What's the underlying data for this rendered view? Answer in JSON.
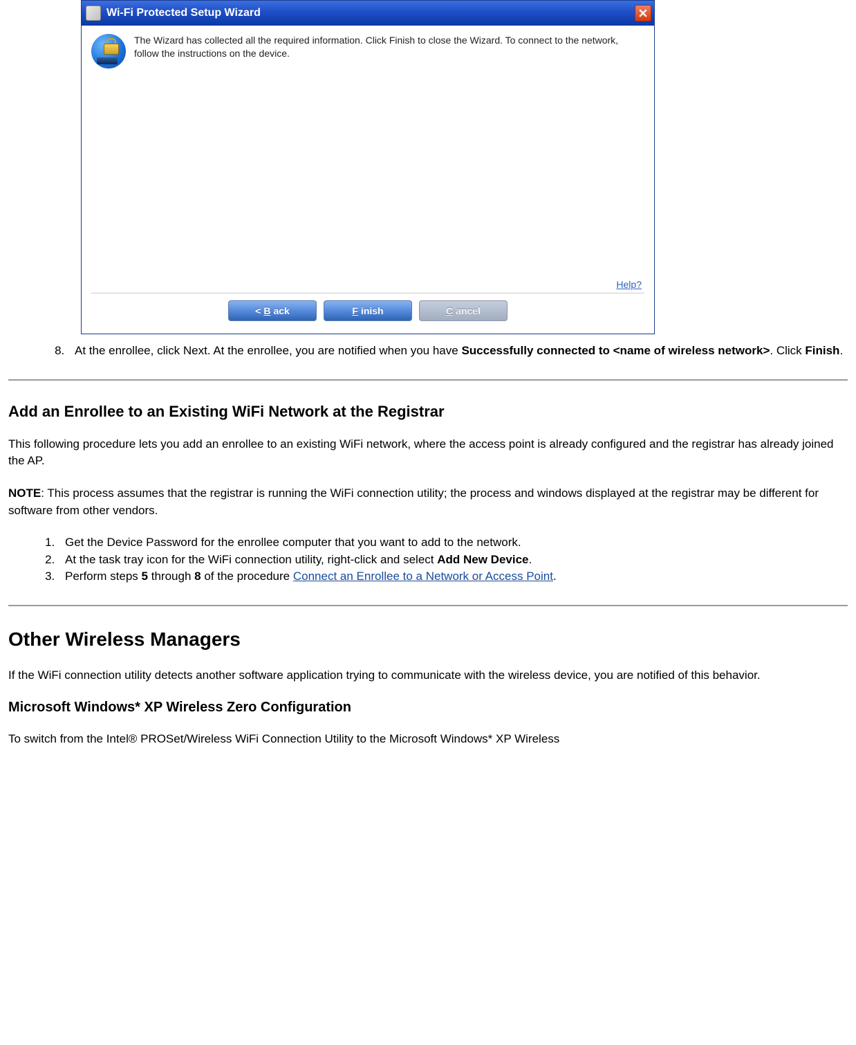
{
  "wizard": {
    "title": "Wi-Fi Protected Setup Wizard",
    "message": "The Wizard has collected all the required information. Click Finish to close the Wizard. To connect to the network, follow the instructions on the device.",
    "help_label": "Help?",
    "buttons": {
      "back_prefix": "<  ",
      "back_letter": "B",
      "back_rest": "ack",
      "finish_letter": "F",
      "finish_rest": "inish",
      "cancel_letter": "C",
      "cancel_rest": "ancel"
    }
  },
  "step8": {
    "number": "8.",
    "prefix": "At the enrollee, click Next. At the enrollee, you are notified when you have ",
    "bold1": "Successfully connected to <name of wireless network>",
    "mid": ". Click ",
    "bold2": "Finish",
    "suffix": "."
  },
  "section1": {
    "heading": "Add an Enrollee to an Existing WiFi Network at the Registrar",
    "para1": "This following procedure lets you add an enrollee to an existing WiFi network, where the access point is already configured and the registrar has already joined the AP.",
    "note_label": "NOTE",
    "note_text": ": This process assumes that the registrar is running the WiFi connection utility; the process and windows displayed at the registrar may be different for software from other vendors.",
    "steps": {
      "s1": "Get the Device Password for the enrollee computer that you want to add to the network.",
      "s2_prefix": "At the task tray icon for the WiFi connection utility, right-click and select ",
      "s2_bold": "Add New Device",
      "s2_suffix": ".",
      "s3_prefix": "Perform steps ",
      "s3_b1": "5",
      "s3_mid1": " through ",
      "s3_b2": "8",
      "s3_mid2": " of the procedure ",
      "s3_link": "Connect an Enrollee to a Network or Access Point",
      "s3_suffix": "."
    }
  },
  "section2": {
    "heading": "Other Wireless Managers",
    "para": "If the WiFi connection utility detects another software application trying to communicate with the wireless device, you are notified of this behavior.",
    "subheading": "Microsoft Windows* XP Wireless Zero Configuration",
    "para2": "To switch from the Intel® PROSet/Wireless WiFi Connection Utility to the Microsoft Windows* XP Wireless"
  }
}
